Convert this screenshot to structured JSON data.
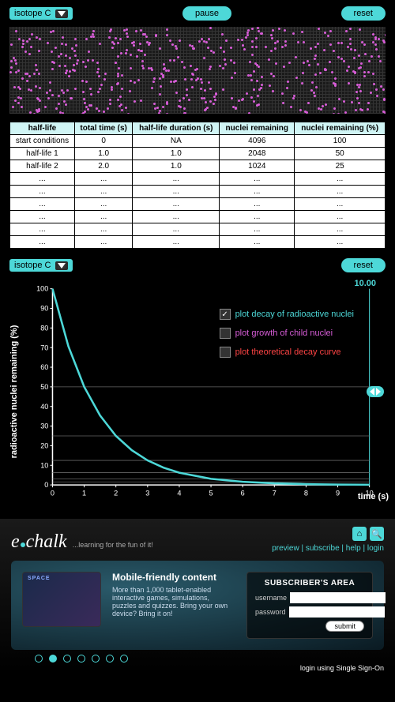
{
  "toolbar": {
    "isotope_label": "isotope C",
    "pause_label": "pause",
    "reset_label": "reset"
  },
  "table": {
    "headers": [
      "half-life",
      "total time (s)",
      "half-life duration (s)",
      "nuclei remaining",
      "nuclei remaining (%)"
    ],
    "rows": [
      [
        "start conditions",
        "0",
        "NA",
        "4096",
        "100"
      ],
      [
        "half-life 1",
        "1.0",
        "1.0",
        "2048",
        "50"
      ],
      [
        "half-life 2",
        "2.0",
        "1.0",
        "1024",
        "25"
      ],
      [
        "...",
        "...",
        "...",
        "...",
        "..."
      ],
      [
        "...",
        "...",
        "...",
        "...",
        "..."
      ],
      [
        "...",
        "...",
        "...",
        "...",
        "..."
      ],
      [
        "...",
        "...",
        "...",
        "...",
        "..."
      ],
      [
        "...",
        "...",
        "...",
        "...",
        "..."
      ],
      [
        "...",
        "...",
        "...",
        "...",
        "..."
      ]
    ]
  },
  "chart_toolbar": {
    "isotope_label": "isotope C",
    "reset_label": "reset"
  },
  "chart": {
    "y_label": "radioactive nuclei remaining (%)",
    "x_label": "time (s)",
    "time_value": "10.00",
    "legend": [
      {
        "checked": true,
        "label": "plot decay of radioactive nuclei",
        "color": "teal"
      },
      {
        "checked": false,
        "label": "plot growth of child nuclei",
        "color": "pink"
      },
      {
        "checked": false,
        "label": "plot theoretical decay curve",
        "color": "red"
      }
    ]
  },
  "chart_data": {
    "type": "line",
    "title": "",
    "xlabel": "time (s)",
    "ylabel": "radioactive nuclei remaining (%)",
    "xlim": [
      0,
      10
    ],
    "ylim": [
      0,
      100
    ],
    "x_ticks": [
      0,
      1,
      2,
      3,
      4,
      5,
      6,
      7,
      8,
      9,
      10
    ],
    "y_ticks": [
      0,
      10,
      20,
      30,
      40,
      50,
      60,
      70,
      80,
      90,
      100
    ],
    "series": [
      {
        "name": "decay of radioactive nuclei",
        "color": "#4dd8d8",
        "x": [
          0,
          0.5,
          1,
          1.5,
          2,
          2.5,
          3,
          3.5,
          4,
          5,
          6,
          7,
          8,
          9,
          10
        ],
        "y": [
          100,
          70.7,
          50,
          35.4,
          25,
          17.7,
          12.5,
          8.8,
          6.25,
          3.1,
          1.6,
          0.8,
          0.4,
          0.2,
          0.1
        ]
      }
    ],
    "half_life_markers_y": [
      50,
      25,
      12.5,
      6.25,
      3.125,
      1.5625
    ]
  },
  "footer": {
    "brand": "chalk",
    "tagline": "...learning for the fun of it!",
    "nav": {
      "preview": "preview",
      "subscribe": "subscribe",
      "help": "help",
      "login": "login"
    },
    "promo": {
      "title": "Mobile-friendly content",
      "body": "More than 1,000 tablet-enabled interactive games, simulations, puzzles and quizzes. Bring your own device? Bring it on!"
    },
    "sub": {
      "title": "SUBSCRIBER'S AREA",
      "username_label": "username",
      "password_label": "password",
      "submit_label": "submit"
    },
    "sso_prefix": "login using ",
    "sso_link": "Single Sign-On",
    "pager_active": 1,
    "pager_count": 7
  }
}
